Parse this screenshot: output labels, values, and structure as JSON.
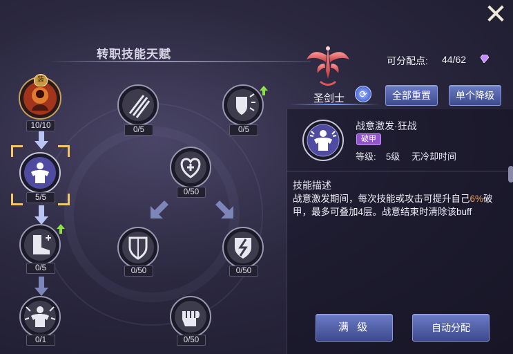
{
  "header": {
    "title": "转职技能天赋",
    "points_label": "可分配点:",
    "points_value": "44/62"
  },
  "class": {
    "name": "圣剑士"
  },
  "buttons": {
    "reset_all": "全部重置",
    "single_down": "单个降级",
    "max_level": "满 级",
    "auto_assign": "自动分配"
  },
  "skill_detail": {
    "name": "战意激发·狂战",
    "tag": "破甲",
    "level_label": "等级:",
    "level_value": "5级",
    "cooldown": "无冷却时间",
    "desc_title": "技能描述",
    "desc_part1": "战意激发期间，每次技能或攻击可提升自己",
    "desc_highlight": "6%",
    "desc_part2": "破甲，最多可叠加4层。战意结束时清除该buff"
  },
  "equip_badge": "装",
  "nodes": [
    {
      "id": "warrior-portrait",
      "count": "10/10",
      "icon": "warrior-portrait-icon"
    },
    {
      "id": "claw",
      "count": "0/5",
      "icon": "claw-slash-icon"
    },
    {
      "id": "shield-burst",
      "count": "0/5",
      "icon": "shield-burst-icon"
    },
    {
      "id": "rage-body",
      "count": "5/5",
      "icon": "rage-body-icon"
    },
    {
      "id": "heart-plus",
      "count": "0/50",
      "icon": "heart-plus-icon"
    },
    {
      "id": "boots",
      "count": "0/5",
      "icon": "boots-plus-icon"
    },
    {
      "id": "shield",
      "count": "0/50",
      "icon": "shield-icon"
    },
    {
      "id": "cracked-shield",
      "count": "0/50",
      "icon": "cracked-shield-icon"
    },
    {
      "id": "rage-burst",
      "count": "0/1",
      "icon": "rage-burst-icon"
    },
    {
      "id": "fist",
      "count": "0/50",
      "icon": "fist-icon"
    }
  ]
}
